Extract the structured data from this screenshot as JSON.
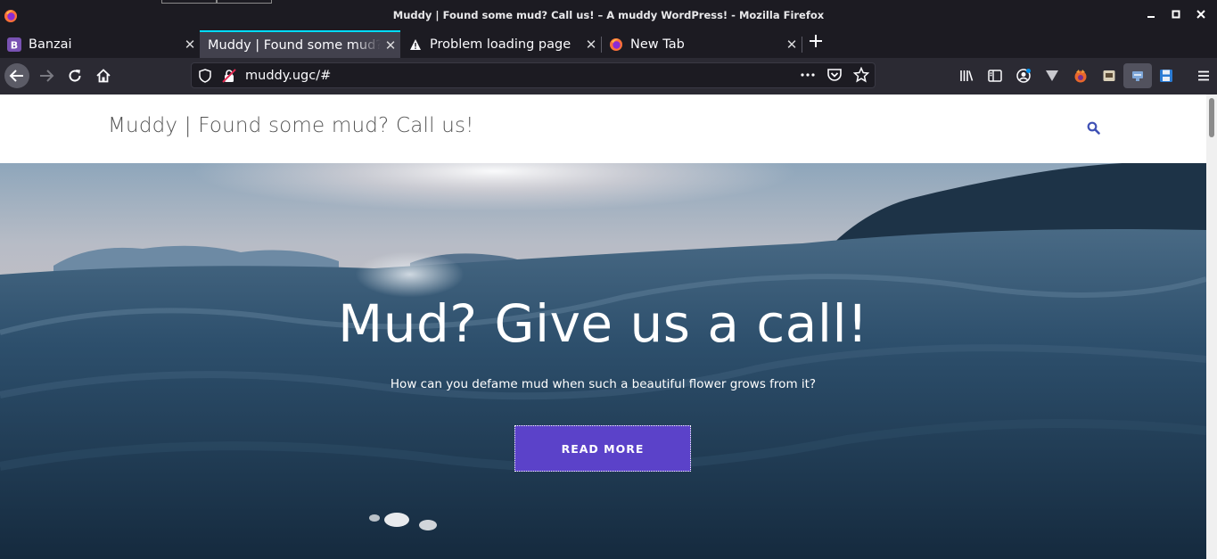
{
  "window": {
    "title": "Muddy | Found some mud? Call us! – A muddy WordPress! - Mozilla Firefox"
  },
  "tabs": [
    {
      "label": "Banzai",
      "favicon": "banzai-b-icon",
      "active": false
    },
    {
      "label": "Muddy | Found some mud? Call us!",
      "favicon": "none",
      "active": true
    },
    {
      "label": "Problem loading page",
      "favicon": "warning-icon",
      "active": false
    },
    {
      "label": "New Tab",
      "favicon": "firefox-icon",
      "active": false
    }
  ],
  "urlbar": {
    "url": "muddy.ugc/#"
  },
  "site": {
    "title": "Muddy | Found some mud? Call us!"
  },
  "hero": {
    "heading": "Mud? Give us a call!",
    "subheading": "How can you defame mud when such a beautiful flower grows from it?",
    "button_label": "READ MORE"
  },
  "colors": {
    "accent_tab": "#00ddff",
    "hero_button": "#5b42c9",
    "search_icon": "#3f51b5"
  }
}
